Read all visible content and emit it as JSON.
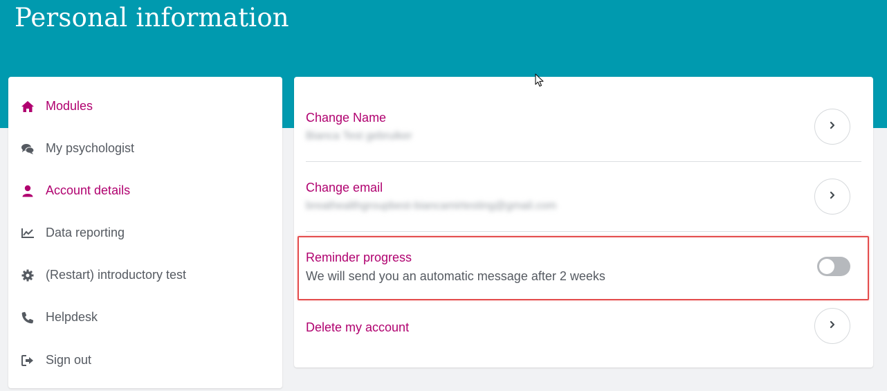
{
  "header": {
    "title": "Personal information"
  },
  "sidebar": {
    "items": [
      {
        "label": "Modules",
        "icon": "home-icon",
        "active": true
      },
      {
        "label": "My psychologist",
        "icon": "chat-icon",
        "active": false
      },
      {
        "label": "Account details",
        "icon": "user-icon",
        "active": true
      },
      {
        "label": "Data reporting",
        "icon": "line-chart-icon",
        "active": false
      },
      {
        "label": "(Restart) introductory test",
        "icon": "gear-icon",
        "active": false
      },
      {
        "label": "Helpdesk",
        "icon": "phone-icon",
        "active": false
      },
      {
        "label": "Sign out",
        "icon": "sign-out-icon",
        "active": false
      }
    ]
  },
  "panel": {
    "name": {
      "title": "Change Name",
      "value": "Bianca Test gebruiker"
    },
    "email": {
      "title": "Change email",
      "value": "breathealthgroupbest-biancamirtesting@gmail.com"
    },
    "reminder": {
      "title": "Reminder progress",
      "description": "We will send you an automatic message after 2 weeks",
      "enabled": false
    },
    "delete": {
      "title": "Delete my account"
    }
  },
  "colors": {
    "header": "#009aaf",
    "accent": "#b0006f",
    "text": "#555a61",
    "highlight": "#e44d4d"
  }
}
